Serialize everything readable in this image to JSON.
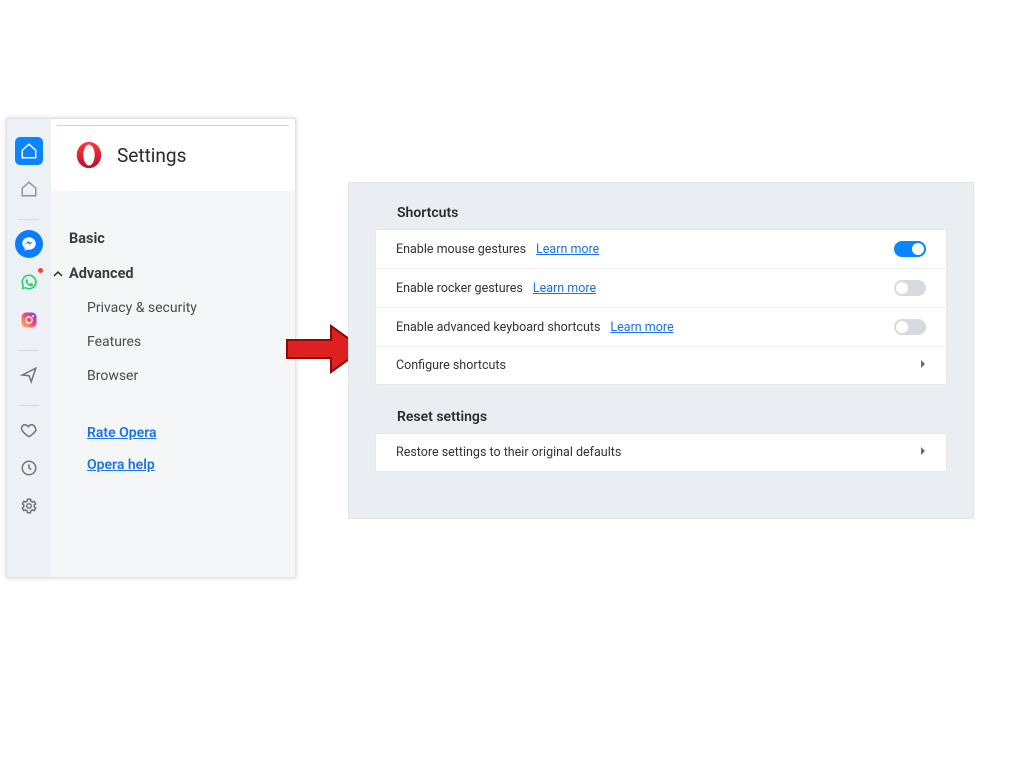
{
  "settings_title": "Settings",
  "rail": {
    "icons": [
      "home",
      "outline-home",
      "messenger",
      "whatsapp",
      "instagram",
      "send",
      "heart",
      "clock",
      "gear"
    ]
  },
  "nav": {
    "basic": "Basic",
    "advanced": "Advanced",
    "privacy": "Privacy & security",
    "features": "Features",
    "browser": "Browser"
  },
  "links": {
    "rate": "Rate Opera",
    "help": "Opera help"
  },
  "shortcuts": {
    "title": "Shortcuts",
    "learn_more": "Learn more",
    "mouse": "Enable mouse gestures",
    "rocker": "Enable rocker gestures",
    "keyboard": "Enable advanced keyboard shortcuts",
    "configure": "Configure shortcuts",
    "toggles": {
      "mouse": true,
      "rocker": false,
      "keyboard": false
    }
  },
  "reset": {
    "title": "Reset settings",
    "restore": "Restore settings to their original defaults"
  },
  "colors": {
    "accent": "#0a84ff",
    "link": "#1a73e8",
    "arrow": "#e02020"
  }
}
